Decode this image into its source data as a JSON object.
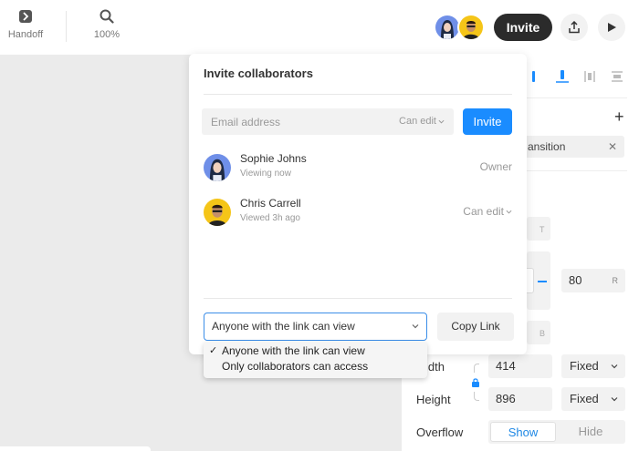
{
  "toolbar": {
    "handoff_label": "Handoff",
    "zoom_label": "100%",
    "invite_label": "Invite"
  },
  "modal": {
    "title": "Invite collaborators",
    "email_placeholder": "Email address",
    "email_value": "",
    "permission": "Can edit",
    "invite_button": "Invite",
    "members": [
      {
        "name": "Sophie Johns",
        "status": "Viewing now",
        "role": "Owner"
      },
      {
        "name": "Chris Carrell",
        "status": "Viewed 3h ago",
        "role": "Can edit"
      }
    ],
    "link_access": "Anyone with the link can view",
    "copy_link": "Copy Link"
  },
  "link_dropdown": {
    "options": [
      "Anyone with the link can view",
      "Only collaborators can access"
    ],
    "selected_index": 0,
    "check": "✓"
  },
  "right_panel": {
    "transition_chip": "ansition",
    "top_letter": "T",
    "radius_value": "80",
    "radius_unit": "R",
    "bottom_letter": "B",
    "width_label": "idth",
    "width_value": "414",
    "width_mode": "Fixed",
    "height_label": "Height",
    "height_value": "896",
    "height_mode": "Fixed",
    "overflow_label": "Overflow",
    "overflow_show": "Show",
    "overflow_hide": "Hide"
  },
  "colors": {
    "accent": "#1a8cff",
    "dark_button": "#2b2b2b",
    "avatar_sophie_bg": "#6f8fe8",
    "avatar_chris_bg": "#f5c518"
  }
}
